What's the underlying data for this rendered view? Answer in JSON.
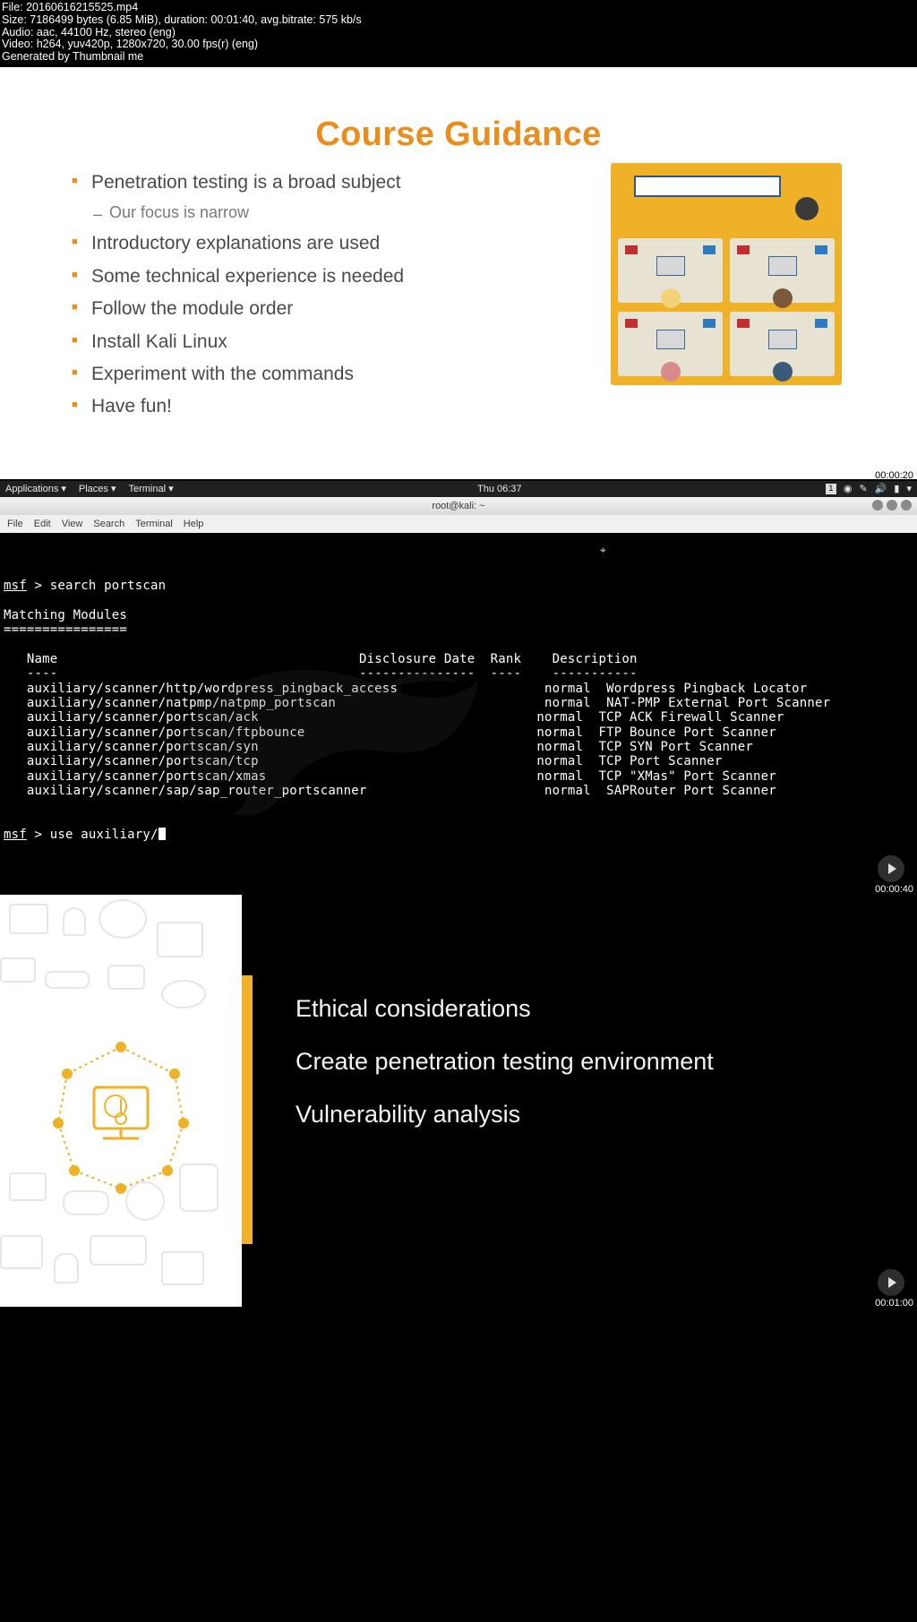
{
  "meta": {
    "file": "File: 20160616215525.mp4",
    "size": "Size: 7186499 bytes (6.85 MiB), duration: 00:01:40, avg.bitrate: 575 kb/s",
    "audio": "Audio: aac, 44100 Hz, stereo (eng)",
    "video": "Video: h264, yuv420p, 1280x720, 30.00 fps(r) (eng)",
    "gen": "Generated by Thumbnail me"
  },
  "timestamps": {
    "t1": "00:00:20",
    "t2": "00:00:40",
    "t3": "00:01:00"
  },
  "slide1": {
    "title": "Course Guidance",
    "bullets": [
      "Penetration testing is a broad subject",
      "Our focus is narrow",
      "Introductory explanations are used",
      "Some technical experience is needed",
      "Follow the module order",
      "Install Kali Linux",
      "Experiment with the commands",
      "Have fun!"
    ]
  },
  "kali": {
    "bar": {
      "apps": "Applications ▾",
      "places": "Places ▾",
      "term": "Terminal ▾",
      "clock": "Thu 06:37",
      "ws": "1"
    },
    "title": "root@kali: ~",
    "menu": [
      "File",
      "Edit",
      "View",
      "Search",
      "Terminal",
      "Help"
    ],
    "prompt1_cmd": "search portscan",
    "heading": "Matching Modules",
    "underline": "================",
    "columns": {
      "name": "Name",
      "date": "Disclosure Date",
      "rank": "Rank",
      "desc": "Description"
    },
    "col_dash": {
      "name": "----",
      "date": "---------------",
      "rank": "----",
      "desc": "-----------"
    },
    "rows": [
      {
        "n": "auxiliary/scanner/http/wordpress_pingback_access",
        "r": "normal",
        "d": "Wordpress Pingback Locator"
      },
      {
        "n": "auxiliary/scanner/natpmp/natpmp_portscan",
        "r": "normal",
        "d": "NAT-PMP External Port Scanner"
      },
      {
        "n": "auxiliary/scanner/portscan/ack",
        "r": "normal",
        "d": "TCP ACK Firewall Scanner"
      },
      {
        "n": "auxiliary/scanner/portscan/ftpbounce",
        "r": "normal",
        "d": "FTP Bounce Port Scanner"
      },
      {
        "n": "auxiliary/scanner/portscan/syn",
        "r": "normal",
        "d": "TCP SYN Port Scanner"
      },
      {
        "n": "auxiliary/scanner/portscan/tcp",
        "r": "normal",
        "d": "TCP Port Scanner"
      },
      {
        "n": "auxiliary/scanner/portscan/xmas",
        "r": "normal",
        "d": "TCP \"XMas\" Port Scanner"
      },
      {
        "n": "auxiliary/scanner/sap/sap_router_portscanner",
        "r": "normal",
        "d": "SAPRouter Port Scanner"
      }
    ],
    "prompt2_cmd": "use auxiliary/"
  },
  "slide3": {
    "topics": [
      "Ethical considerations",
      "Create penetration testing environment",
      "Vulnerability analysis"
    ]
  }
}
